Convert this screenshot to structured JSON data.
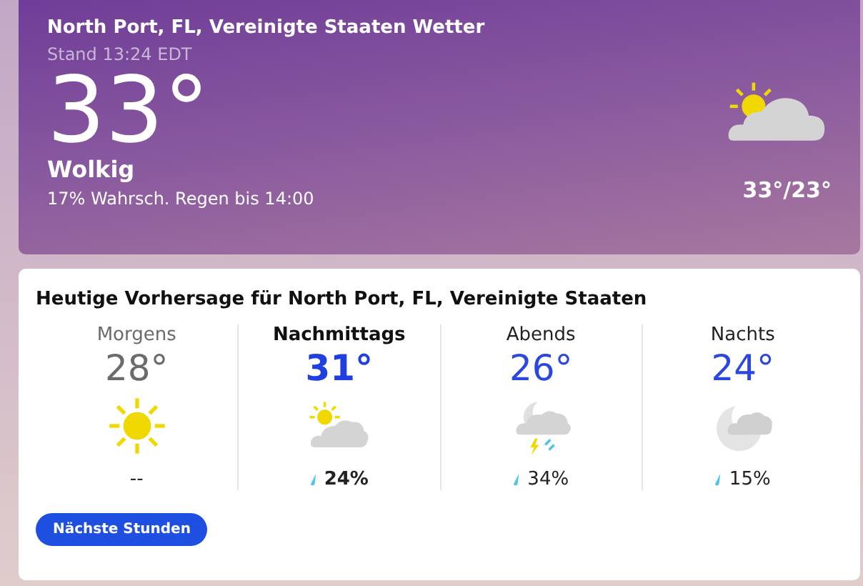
{
  "current": {
    "title": "North Port, FL, Vereinigte Staaten Wetter",
    "updated": "Stand 13:24 EDT",
    "temperature": "33°",
    "condition": "Wolkig",
    "rain_note": "17% Wahrsch. Regen bis 14:00",
    "kind": "sun-cloud",
    "high_low": "33°/23°"
  },
  "forecast": {
    "title": "Heutige Vorhersage für North Port, FL, Vereinigte Staaten",
    "periods": [
      {
        "label": "Morgens",
        "temperature": "28°",
        "kind": "sun",
        "precip": "--",
        "selected": false,
        "past": true
      },
      {
        "label": "Nachmittags",
        "temperature": "31°",
        "kind": "sun-cloud",
        "precip": "24%",
        "selected": true,
        "past": false
      },
      {
        "label": "Abends",
        "temperature": "26°",
        "kind": "moon-cloud-storm",
        "precip": "34%",
        "selected": false,
        "past": false
      },
      {
        "label": "Nachts",
        "temperature": "24°",
        "kind": "moon-cloud",
        "precip": "15%",
        "selected": false,
        "past": false
      }
    ],
    "button": "Nächste Stunden"
  }
}
